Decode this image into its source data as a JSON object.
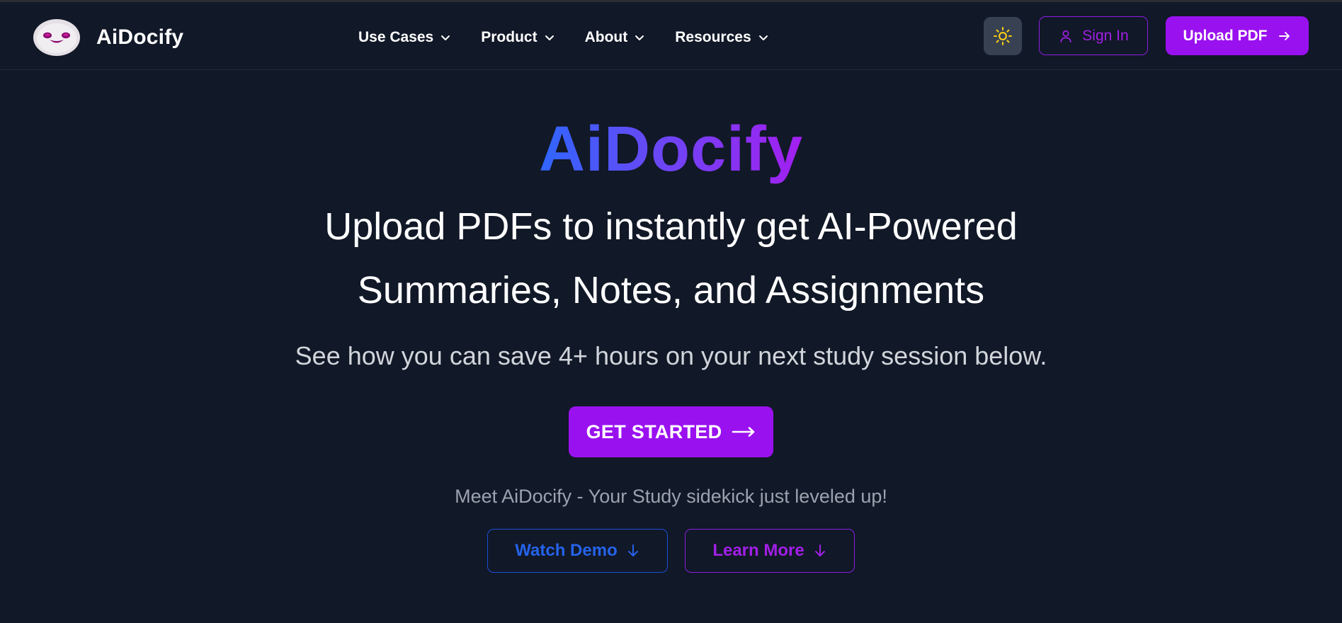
{
  "brand": {
    "name": "AiDocify"
  },
  "nav": {
    "items": [
      {
        "label": "Use Cases",
        "icon": "chevron-down-icon"
      },
      {
        "label": "Product",
        "icon": "chevron-down-icon"
      },
      {
        "label": "About",
        "icon": "chevron-down-icon"
      },
      {
        "label": "Resources",
        "icon": "chevron-down-icon"
      }
    ],
    "theme_toggle_icon": "sun-icon",
    "sign_in_label": "Sign In",
    "upload_label": "Upload PDF"
  },
  "hero": {
    "title": "AiDocify",
    "headline_line1": "Upload PDFs to instantly get AI-Powered",
    "headline_line2": "Summaries, Notes, and Assignments",
    "subline": "See how you can save 4+ hours on your next study session below.",
    "cta_label": "GET STARTED",
    "tagline": "Meet AiDocify - Your Study sidekick just leveled up!",
    "watch_demo_label": "Watch Demo",
    "learn_more_label": "Learn More"
  },
  "colors": {
    "background": "#111827",
    "accent_purple": "#9a11f0",
    "accent_blue": "#2563eb",
    "theme_button_bg": "#374151"
  }
}
